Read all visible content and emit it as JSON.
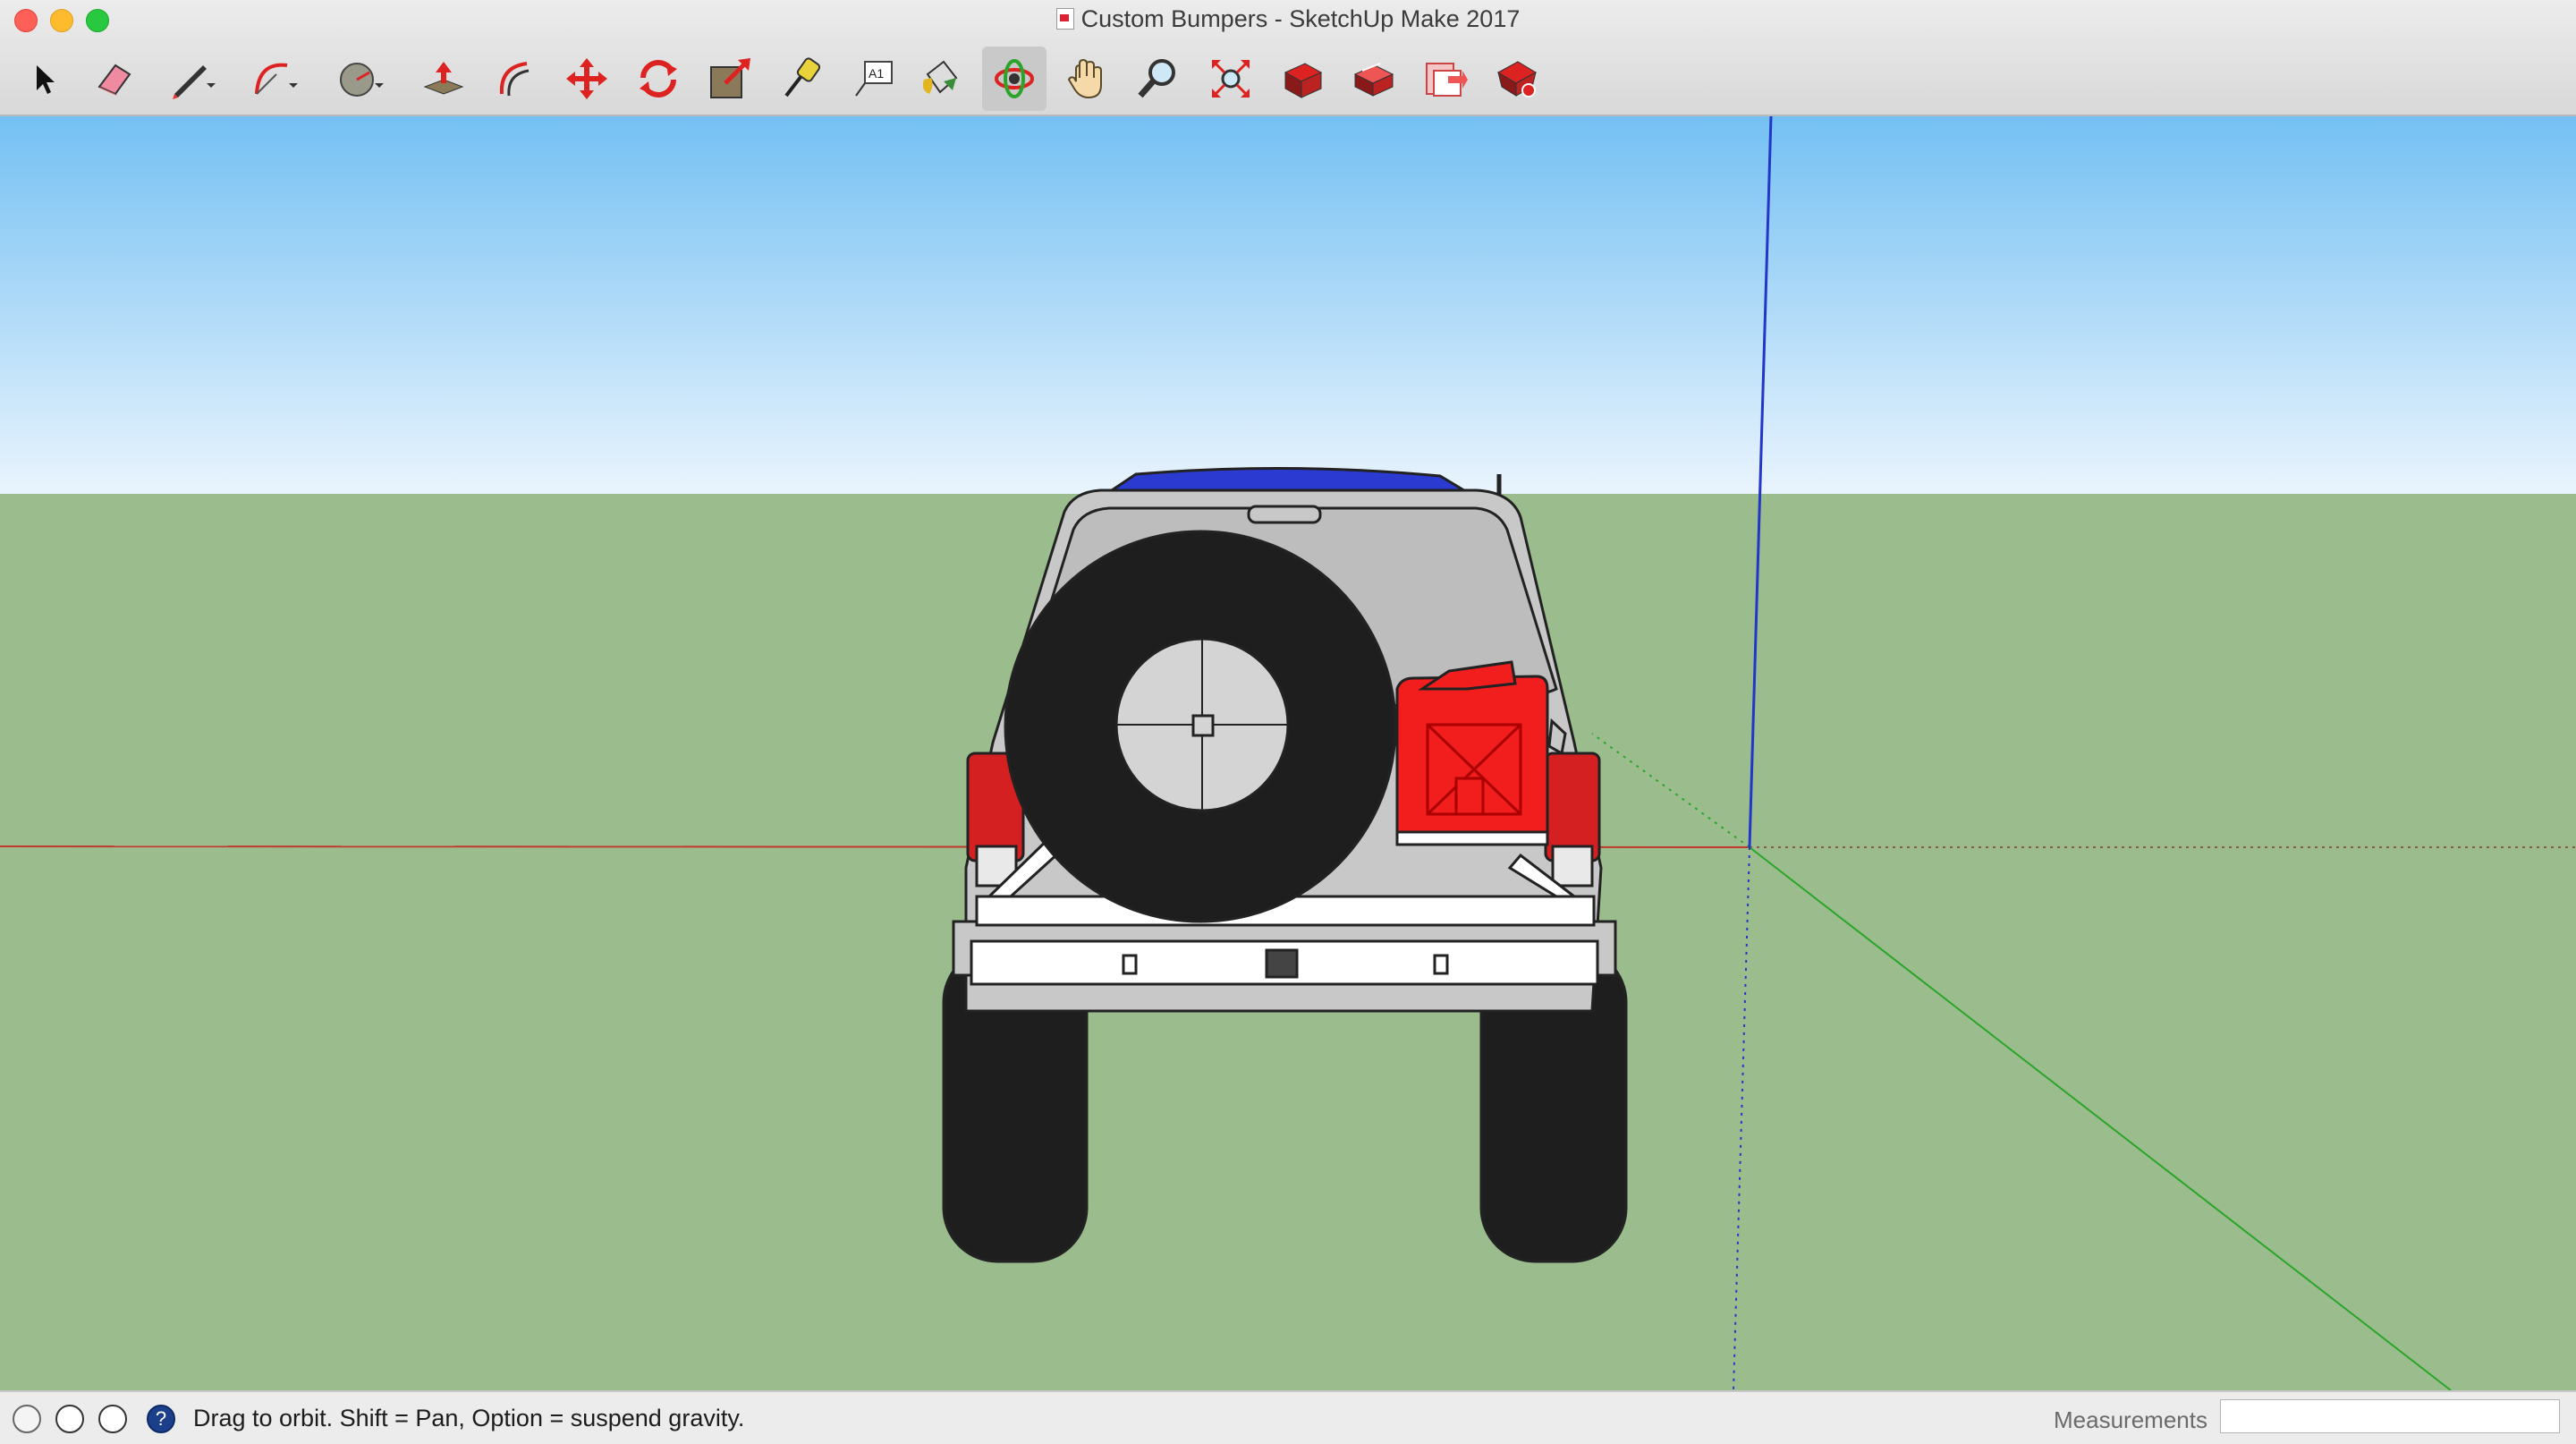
{
  "window": {
    "title": "Custom Bumpers - SketchUp Make 2017"
  },
  "toolbar": {
    "tools": [
      {
        "id": "select",
        "icon": "select-arrow-icon"
      },
      {
        "id": "eraser",
        "icon": "eraser-icon"
      },
      {
        "id": "line",
        "icon": "pencil-icon"
      },
      {
        "id": "arc",
        "icon": "arc-icon"
      },
      {
        "id": "shape",
        "icon": "circle-shape-icon"
      },
      {
        "id": "pushpull",
        "icon": "push-pull-icon"
      },
      {
        "id": "offset",
        "icon": "offset-icon"
      },
      {
        "id": "move",
        "icon": "move-icon"
      },
      {
        "id": "rotate",
        "icon": "rotate-icon"
      },
      {
        "id": "scale",
        "icon": "scale-icon"
      },
      {
        "id": "tape",
        "icon": "tape-measure-icon"
      },
      {
        "id": "text",
        "icon": "text-icon"
      },
      {
        "id": "paint",
        "icon": "paint-bucket-icon"
      },
      {
        "id": "orbit",
        "icon": "orbit-icon",
        "active": true
      },
      {
        "id": "pan",
        "icon": "pan-hand-icon"
      },
      {
        "id": "zoom",
        "icon": "zoom-icon"
      },
      {
        "id": "zoom-extents",
        "icon": "zoom-extents-icon"
      },
      {
        "id": "warehouse",
        "icon": "3d-warehouse-icon"
      },
      {
        "id": "share",
        "icon": "share-model-icon"
      },
      {
        "id": "extension-manager",
        "icon": "extension-manager-icon"
      },
      {
        "id": "extension-warehouse",
        "icon": "extension-warehouse-icon"
      }
    ],
    "text_tool_glyph": "A1"
  },
  "status": {
    "hint": "Drag to orbit. Shift = Pan, Option = suspend gravity.",
    "measurements_label": "Measurements",
    "measurements_value": ""
  },
  "scene": {
    "sky_top": "#74c0f3",
    "sky_bottom": "#e9f4fd",
    "ground": "#9bbd8e",
    "red_axis": "#c0392b",
    "green_axis": "#2aa52a",
    "blue_axis": "#2236c8",
    "vehicle_body": "#c8c8c8",
    "roof_rack": "#2b3bd1",
    "jerry_can": "#f21d1d",
    "tire": "#1e1e1e",
    "bumper": "#ffffff"
  }
}
